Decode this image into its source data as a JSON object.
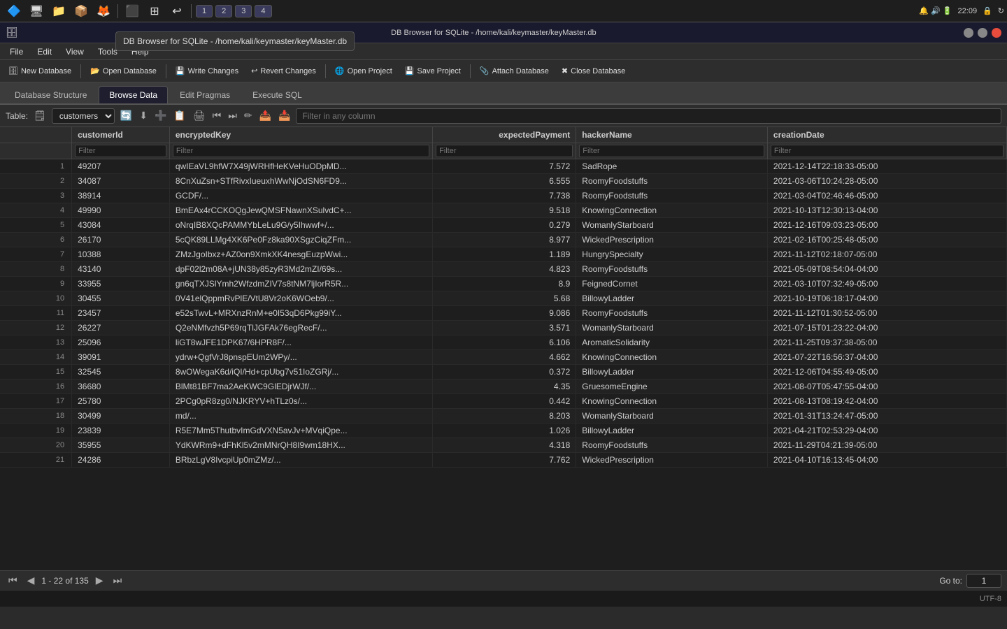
{
  "window": {
    "title": "DB Browser for SQLite - /home/kali/keymaster/keyMaster.db",
    "tooltip": "DB Browser for SQLite - /home/kali/keymaster/keyMaster.db"
  },
  "taskbar": {
    "buttons": [
      "1",
      "2",
      "3",
      "4"
    ],
    "time": "22:09"
  },
  "menubar": {
    "items": [
      "File",
      "Edit",
      "View",
      "Tools",
      "Help"
    ]
  },
  "toolbar": {
    "new_db": "New Database",
    "open_db": "Open Database",
    "write_changes": "Write Changes",
    "revert_changes": "Revert Changes",
    "open_project": "Open Project",
    "save_project": "Save Project",
    "attach_db": "Attach Database",
    "close_db": "Close Database"
  },
  "tabs": {
    "items": [
      "Database Structure",
      "Browse Data",
      "Edit Pragmas",
      "Execute SQL"
    ],
    "active": 1
  },
  "table_controls": {
    "label": "Table:",
    "selected_table": "customers",
    "filter_placeholder": "Filter in any column"
  },
  "columns": {
    "headers": [
      "customerId",
      "encryptedKey",
      "expectedPayment",
      "hackerName",
      "creationDate"
    ],
    "filters": [
      "Filter",
      "Filter",
      "Filter",
      "Filter",
      "Filter"
    ]
  },
  "rows": [
    {
      "num": 1,
      "id": "49207",
      "key": "qwIEaVL9hfW7X49jWRHfHeKVeHuODpMD...",
      "payment": "7.572",
      "hacker": "SadRope",
      "date": "2021-12-14T22:18:33-05:00"
    },
    {
      "num": 2,
      "id": "34087",
      "key": "8CnXuZsn+STfRivxIueuxhWwNjOdSN6FD9...",
      "payment": "6.555",
      "hacker": "RoomyFoodstuffs",
      "date": "2021-03-06T10:24:28-05:00"
    },
    {
      "num": 3,
      "id": "38914",
      "key": "GCDF/...",
      "payment": "7.738",
      "hacker": "RoomyFoodstuffs",
      "date": "2021-03-04T02:46:46-05:00"
    },
    {
      "num": 4,
      "id": "49990",
      "key": "BmEAx4rCCKOQgJewQMSFNawnXSulvdC+...",
      "payment": "9.518",
      "hacker": "KnowingConnection",
      "date": "2021-10-13T12:30:13-04:00"
    },
    {
      "num": 5,
      "id": "43084",
      "key": "oNrqIB8XQcPAMMYbLeLu9G/y5Ihwwf+/...",
      "payment": "0.279",
      "hacker": "WomanlyStarboard",
      "date": "2021-12-16T09:03:23-05:00"
    },
    {
      "num": 6,
      "id": "26170",
      "key": "5cQK89LLMg4XK6Pe0Fz8ka90XSgzCiqZFm...",
      "payment": "8.977",
      "hacker": "WickedPrescription",
      "date": "2021-02-16T00:25:48-05:00"
    },
    {
      "num": 7,
      "id": "10388",
      "key": "ZMzJgoIbxz+AZ0on9XmkXK4nesgEuzpWwi...",
      "payment": "1.189",
      "hacker": "HungrySpecialty",
      "date": "2021-11-12T02:18:07-05:00"
    },
    {
      "num": 8,
      "id": "43140",
      "key": "dpF02l2m08A+jUN38y85zyR3Md2mZI/69s...",
      "payment": "4.823",
      "hacker": "RoomyFoodstuffs",
      "date": "2021-05-09T08:54:04-04:00"
    },
    {
      "num": 9,
      "id": "33955",
      "key": "gn6qTXJSlYmh2WfzdmZIV7s8tNM7ljIorR5R...",
      "payment": "8.9",
      "hacker": "FeignedCornet",
      "date": "2021-03-10T07:32:49-05:00"
    },
    {
      "num": 10,
      "id": "30455",
      "key": "0V41elQppmRvPlE/VtU8Vr2oK6WOeb9/...",
      "payment": "5.68",
      "hacker": "BillowyLadder",
      "date": "2021-10-19T06:18:17-04:00"
    },
    {
      "num": 11,
      "id": "23457",
      "key": "e52sTwvL+MRXnzRnM+e0I53qD6Pkg99iY...",
      "payment": "9.086",
      "hacker": "RoomyFoodstuffs",
      "date": "2021-11-12T01:30:52-05:00"
    },
    {
      "num": 12,
      "id": "26227",
      "key": "Q2eNMfvzh5P69rqTlJGFAk76egRecF/...",
      "payment": "3.571",
      "hacker": "WomanlyStarboard",
      "date": "2021-07-15T01:23:22-04:00"
    },
    {
      "num": 13,
      "id": "25096",
      "key": "liGT8wJFE1DPK67/6HPR8F/...",
      "payment": "6.106",
      "hacker": "AromaticSolidarity",
      "date": "2021-11-25T09:37:38-05:00"
    },
    {
      "num": 14,
      "id": "39091",
      "key": "ydrw+QgfVrJ8pnspEUm2WPy/...",
      "payment": "4.662",
      "hacker": "KnowingConnection",
      "date": "2021-07-22T16:56:37-04:00"
    },
    {
      "num": 15,
      "id": "32545",
      "key": "8wOWegaK6d/iQI/Hd+cpUbg7v51IoZGRj/...",
      "payment": "0.372",
      "hacker": "BillowyLadder",
      "date": "2021-12-06T04:55:49-05:00"
    },
    {
      "num": 16,
      "id": "36680",
      "key": "BlMt81BF7ma2AeKWC9GlEDjrWJf/...",
      "payment": "4.35",
      "hacker": "GruesomeEngine",
      "date": "2021-08-07T05:47:55-04:00"
    },
    {
      "num": 17,
      "id": "25780",
      "key": "2PCg0pR8zg0/NJKRYV+hTLz0s/...",
      "payment": "0.442",
      "hacker": "KnowingConnection",
      "date": "2021-08-13T08:19:42-04:00"
    },
    {
      "num": 18,
      "id": "30499",
      "key": "md/...",
      "payment": "8.203",
      "hacker": "WomanlyStarboard",
      "date": "2021-01-31T13:24:47-05:00"
    },
    {
      "num": 19,
      "id": "23839",
      "key": "R5E7Mm5ThutbvImGdVXN5avJv+MVqiQpe...",
      "payment": "1.026",
      "hacker": "BillowyLadder",
      "date": "2021-04-21T02:53:29-04:00"
    },
    {
      "num": 20,
      "id": "35955",
      "key": "YdKWRm9+dFhKl5v2mMNrQH8I9wm18HX...",
      "payment": "4.318",
      "hacker": "RoomyFoodstuffs",
      "date": "2021-11-29T04:21:39-05:00"
    },
    {
      "num": 21,
      "id": "24286",
      "key": "BRbzLgV8IvcpiUp0mZMz/...",
      "payment": "7.762",
      "hacker": "WickedPrescription",
      "date": "2021-04-10T16:13:45-04:00"
    }
  ],
  "statusbar": {
    "page_info": "1 - 22 of 135",
    "goto_label": "Go to:",
    "goto_value": "1"
  },
  "bottom_status": {
    "encoding": "UTF-8"
  }
}
